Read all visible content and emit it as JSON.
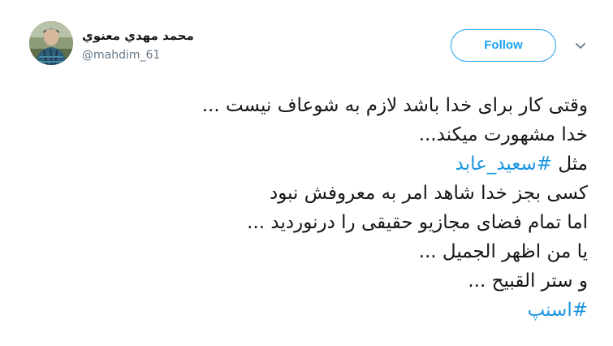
{
  "author": {
    "display_name": "محمد مهدي معنوي",
    "handle": "@mahdim_61"
  },
  "actions": {
    "follow_label": "Follow",
    "more_icon": "chevron-down-icon"
  },
  "tweet": {
    "line_1": "وقتی کار برای خدا باشد لازم به شوعاف نیست ...",
    "line_2": "خدا مشهورت میکند...",
    "line_3_prefix": "مثل",
    "line_3_hashtag": "#سعید_عابد",
    "line_4": "کسی بجز خدا شاهد امر به معروفش نبود",
    "line_5": "اما تمام فضای مجازیو حقیقی را درنوردید ...",
    "line_6": "یا من اظهر الجمیل ...",
    "line_7": "و ستر القبیح ...",
    "line_8_hashtag": "#اسنپ"
  },
  "colors": {
    "brand": "#1da1f2",
    "hashtag": "#1b95e0",
    "text": "#14171a",
    "secondary": "#657786"
  }
}
